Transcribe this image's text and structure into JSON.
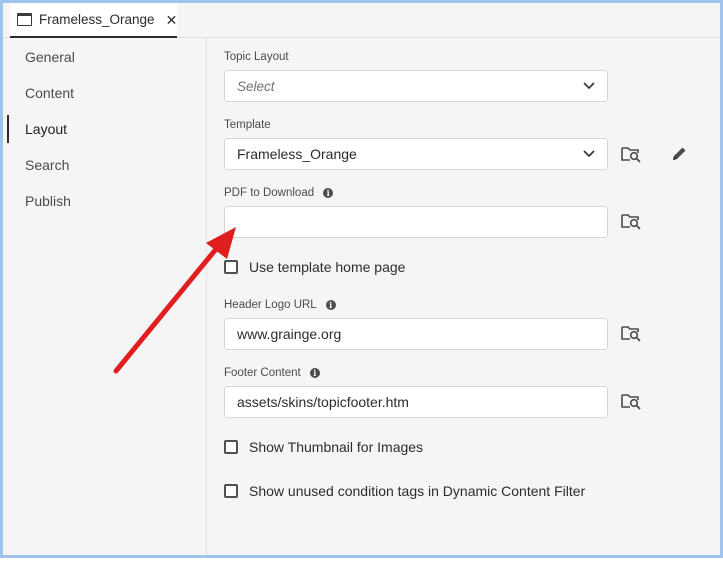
{
  "tab": {
    "title": "Frameless_Orange",
    "close": "✕"
  },
  "sidebar": {
    "items": [
      {
        "label": "General"
      },
      {
        "label": "Content"
      },
      {
        "label": "Layout",
        "active": true
      },
      {
        "label": "Search"
      },
      {
        "label": "Publish"
      }
    ]
  },
  "form": {
    "topic_layout": {
      "label": "Topic Layout",
      "placeholder": "Select"
    },
    "template": {
      "label": "Template",
      "value": "Frameless_Orange"
    },
    "pdf": {
      "label": "PDF to Download",
      "value": ""
    },
    "use_template_home": {
      "label": "Use template home page",
      "checked": false
    },
    "header_logo": {
      "label": "Header Logo URL",
      "value": "www.grainge.org"
    },
    "footer": {
      "label": "Footer Content",
      "value": "assets/skins/topicfooter.htm"
    },
    "show_thumbnail": {
      "label": "Show Thumbnail for Images",
      "checked": false
    },
    "show_unused": {
      "label": "Show unused condition tags in Dynamic Content Filter",
      "checked": false
    }
  },
  "icons": {
    "info": "i",
    "browse": "folder-search-icon",
    "edit": "pencil-icon",
    "chevron": "chevron-down-icon",
    "tab": "window-icon"
  },
  "colors": {
    "frame_border": "#9fc3ea",
    "background": "#f5f5f5",
    "arrow": "#e01e1e"
  }
}
